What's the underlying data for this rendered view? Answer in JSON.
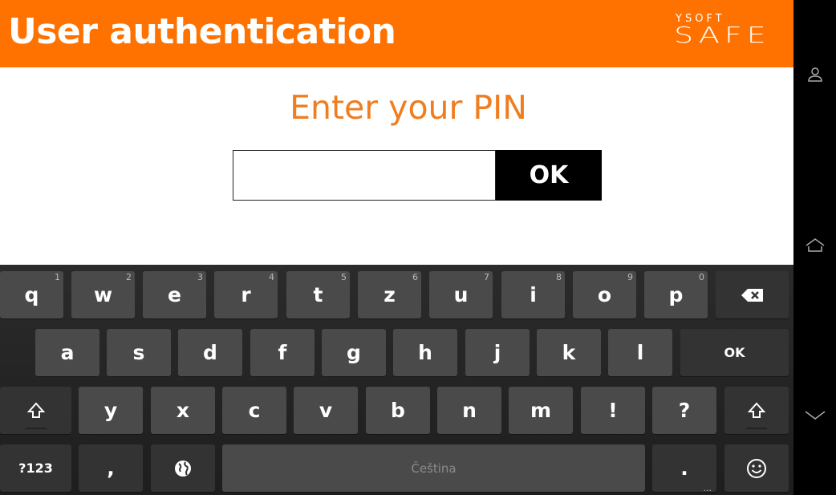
{
  "header": {
    "title": "User authentication",
    "logo_top": "YSOFT",
    "logo_main": "SAFE",
    "color": "#ff7200"
  },
  "login": {
    "prompt": "Enter your PIN",
    "pin_value": "",
    "ok_label": "OK",
    "prompt_color": "#f07d20"
  },
  "keyboard": {
    "row1": [
      "q",
      "w",
      "e",
      "r",
      "t",
      "z",
      "u",
      "i",
      "o",
      "p"
    ],
    "row1_hints": [
      "1",
      "2",
      "3",
      "4",
      "5",
      "6",
      "7",
      "8",
      "9",
      "0"
    ],
    "row2": [
      "a",
      "s",
      "d",
      "f",
      "g",
      "h",
      "j",
      "k",
      "l"
    ],
    "row2_action": "OK",
    "row3": [
      "y",
      "x",
      "c",
      "v",
      "b",
      "n",
      "m",
      "!",
      "?"
    ],
    "symbols_label": "?123",
    "comma_label": ",",
    "space_label": "Čeština",
    "period_label": ".",
    "period_hint": "...",
    "icons": {
      "backspace": "backspace-icon",
      "shift": "shift-icon",
      "language": "globe-icon",
      "emoji": "smiley-icon"
    }
  },
  "navbar": {
    "icons": [
      "user-icon",
      "home-icon",
      "chevron-down-icon"
    ]
  }
}
